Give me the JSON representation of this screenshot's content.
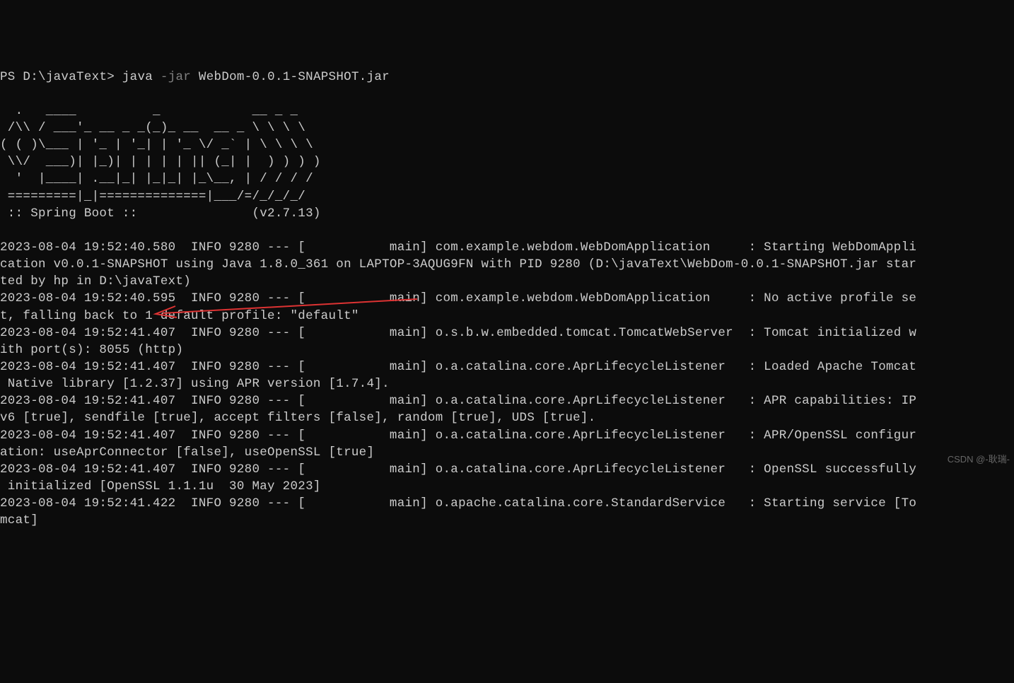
{
  "prompt": {
    "ps": "PS",
    "path": "D:\\javaText>",
    "executable": "java",
    "flag": "-jar",
    "argument": "WebDom-0.0.1-SNAPSHOT.jar"
  },
  "banner": {
    "l1": "  .   ____          _            __ _ _",
    "l2": " /\\\\ / ___'_ __ _ _(_)_ __  __ _ \\ \\ \\ \\",
    "l3": "( ( )\\___ | '_ | '_| | '_ \\/ _` | \\ \\ \\ \\",
    "l4": " \\\\/  ___)| |_)| | | | | || (_| |  ) ) ) )",
    "l5": "  '  |____| .__|_| |_|_| |_\\__, | / / / /",
    "l6": " =========|_|==============|___/=/_/_/_/",
    "l7": " :: Spring Boot ::               (v2.7.13)"
  },
  "logs": {
    "e1": "2023-08-04 19:52:40.580  INFO 9280 --- [           main] com.example.webdom.WebDomApplication     : Starting WebDomAppli",
    "e1b": "cation v0.0.1-SNAPSHOT using Java 1.8.0_361 on LAPTOP-3AQUG9FN with PID 9280 (D:\\javaText\\WebDom-0.0.1-SNAPSHOT.jar star",
    "e1c": "ted by hp in D:\\javaText)",
    "e2": "2023-08-04 19:52:40.595  INFO 9280 --- [           main] com.example.webdom.WebDomApplication     : No active profile se",
    "e2b": "t, falling back to 1 default profile: \"default\"",
    "e3": "2023-08-04 19:52:41.407  INFO 9280 --- [           main] o.s.b.w.embedded.tomcat.TomcatWebServer  : Tomcat initialized w",
    "e3b": "ith port(s): 8055 (http)",
    "e4": "2023-08-04 19:52:41.407  INFO 9280 --- [           main] o.a.catalina.core.AprLifecycleListener   : Loaded Apache Tomcat",
    "e4b": " Native library [1.2.37] using APR version [1.7.4].",
    "e5": "2023-08-04 19:52:41.407  INFO 9280 --- [           main] o.a.catalina.core.AprLifecycleListener   : APR capabilities: IP",
    "e5b": "v6 [true], sendfile [true], accept filters [false], random [true], UDS [true].",
    "e6": "2023-08-04 19:52:41.407  INFO 9280 --- [           main] o.a.catalina.core.AprLifecycleListener   : APR/OpenSSL configur",
    "e6b": "ation: useAprConnector [false], useOpenSSL [true]",
    "e7": "2023-08-04 19:52:41.407  INFO 9280 --- [           main] o.a.catalina.core.AprLifecycleListener   : OpenSSL successfully",
    "e7b": " initialized [OpenSSL 1.1.1u  30 May 2023]",
    "e8": "2023-08-04 19:52:41.422  INFO 9280 --- [           main] o.apache.catalina.core.StandardService   : Starting service [To",
    "e8b": "mcat]"
  },
  "watermark": "CSDN @-耿瑞-"
}
